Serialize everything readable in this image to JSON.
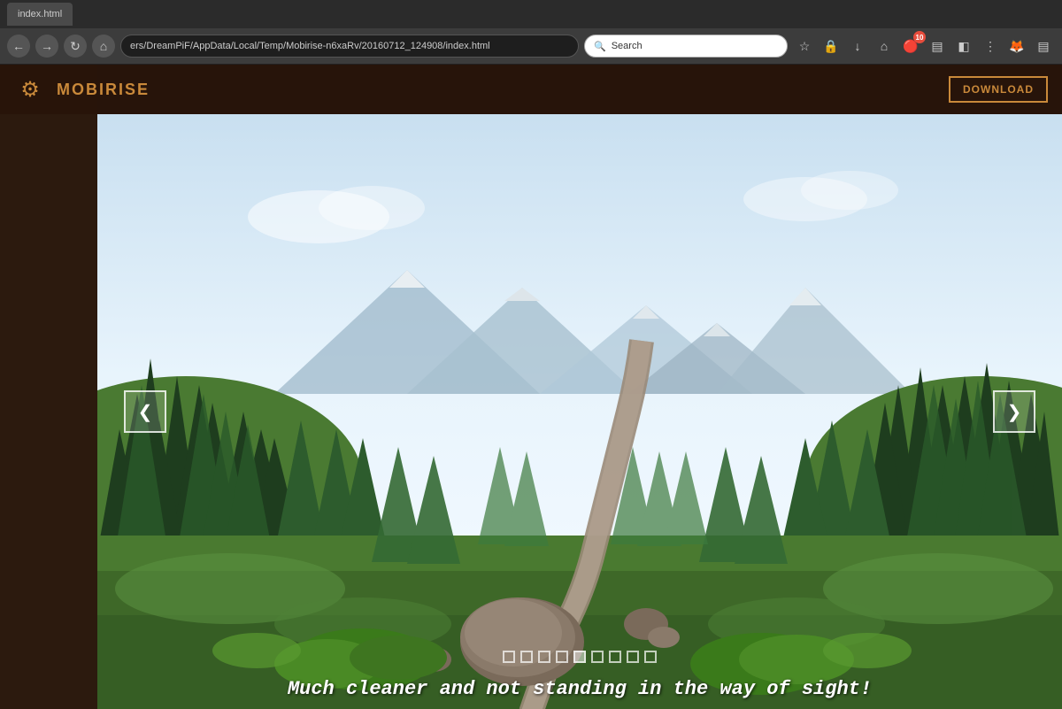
{
  "browser": {
    "address": "ers/DreamPiF/AppData/Local/Temp/Mobirise-n6xaRv/20160712_124908/index.html",
    "reload_title": "Reload",
    "search_placeholder": "Search",
    "tab_label": "index.html",
    "back_label": "←",
    "forward_label": "→",
    "home_label": "⌂",
    "refresh_label": "↻",
    "bookmark_label": "☆",
    "lock_label": "🔒",
    "download_label": "↓",
    "notifications_count": "10"
  },
  "app": {
    "title": "MO",
    "full_title": "MOBIRISE",
    "download_button": "DOWNLOAD",
    "gear_icon": "⚙"
  },
  "slider": {
    "caption": "Much cleaner and not standing in the way of sight!",
    "dots_count": 9,
    "active_dot": 4,
    "arrow_left": "❮",
    "arrow_right": "❯"
  }
}
